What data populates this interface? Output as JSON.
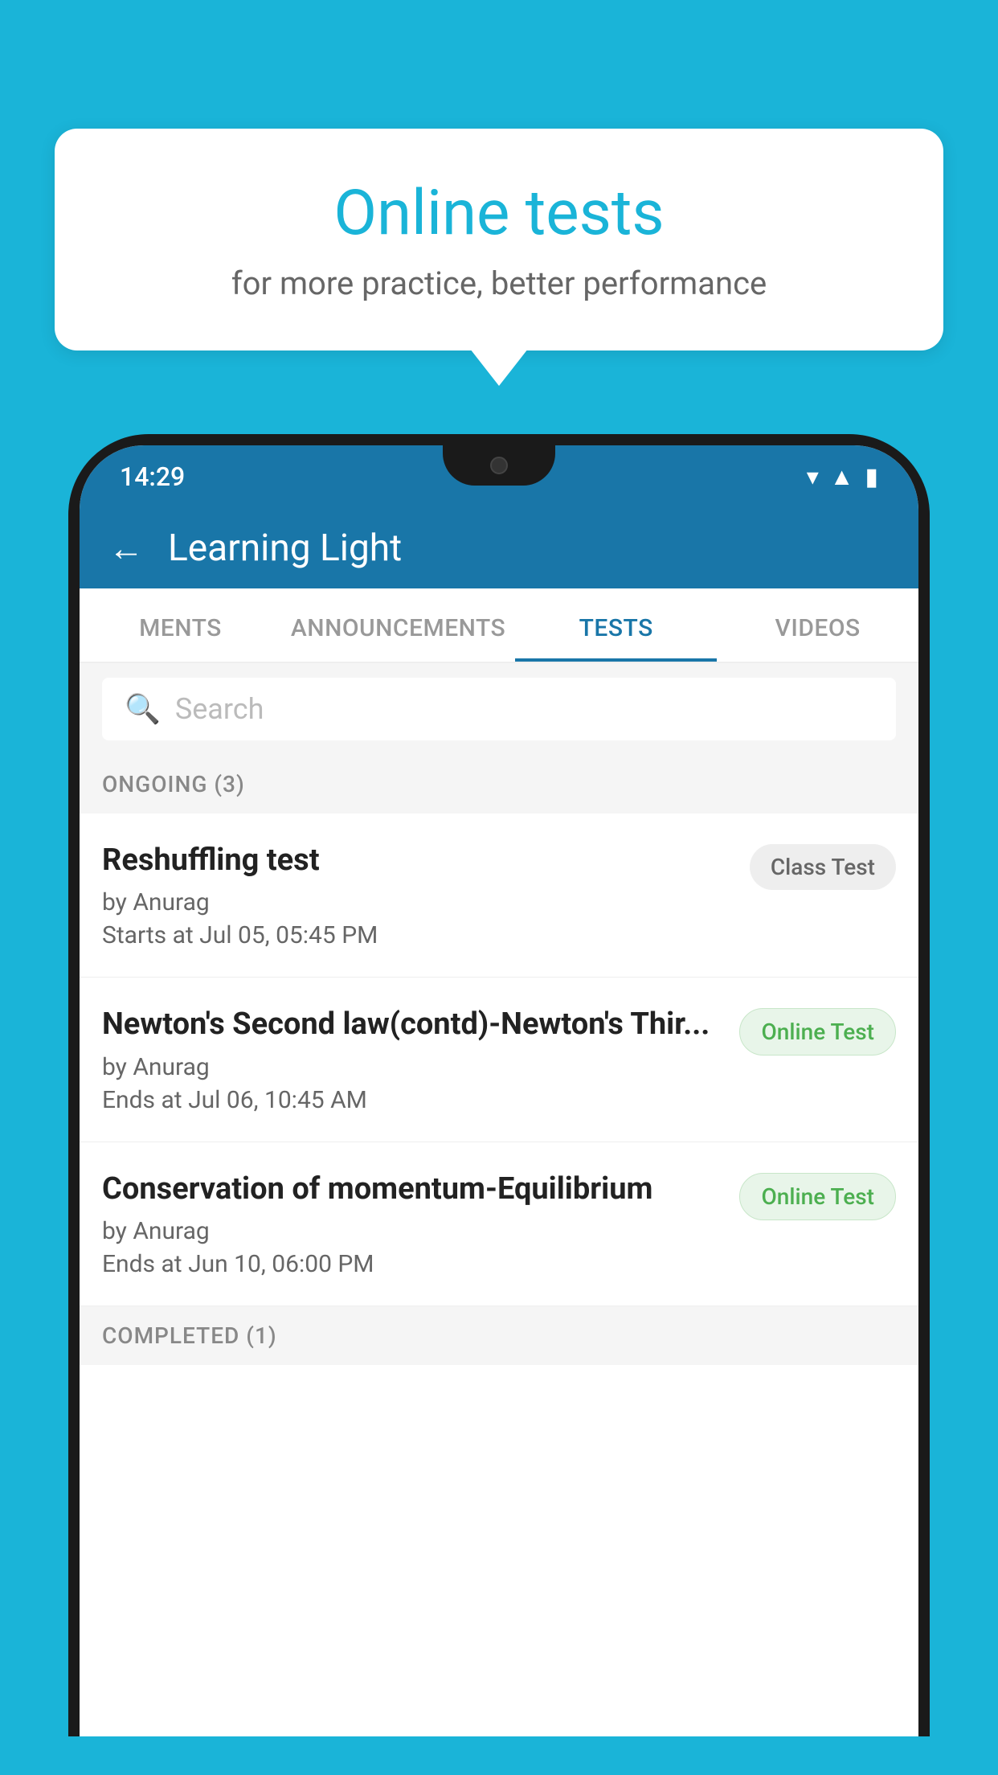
{
  "background": {
    "color": "#1ab4d8"
  },
  "speech_bubble": {
    "title": "Online tests",
    "subtitle": "for more practice, better performance"
  },
  "phone": {
    "status_bar": {
      "time": "14:29",
      "wifi_icon": "▼",
      "signal_icon": "◢",
      "battery_icon": "▮"
    },
    "app_header": {
      "back_label": "←",
      "title": "Learning Light"
    },
    "tabs": [
      {
        "label": "MENTS",
        "active": false
      },
      {
        "label": "ANNOUNCEMENTS",
        "active": false
      },
      {
        "label": "TESTS",
        "active": true
      },
      {
        "label": "VIDEOS",
        "active": false
      }
    ],
    "search": {
      "placeholder": "Search",
      "icon": "🔍"
    },
    "ongoing_section": {
      "label": "ONGOING (3)"
    },
    "tests": [
      {
        "name": "Reshuffling test",
        "by": "by Anurag",
        "time_label": "Starts at",
        "time": "Jul 05, 05:45 PM",
        "badge": "Class Test",
        "badge_type": "class"
      },
      {
        "name": "Newton's Second law(contd)-Newton's Thir...",
        "by": "by Anurag",
        "time_label": "Ends at",
        "time": "Jul 06, 10:45 AM",
        "badge": "Online Test",
        "badge_type": "online"
      },
      {
        "name": "Conservation of momentum-Equilibrium",
        "by": "by Anurag",
        "time_label": "Ends at",
        "time": "Jun 10, 06:00 PM",
        "badge": "Online Test",
        "badge_type": "online"
      }
    ],
    "completed_section": {
      "label": "COMPLETED (1)"
    }
  }
}
